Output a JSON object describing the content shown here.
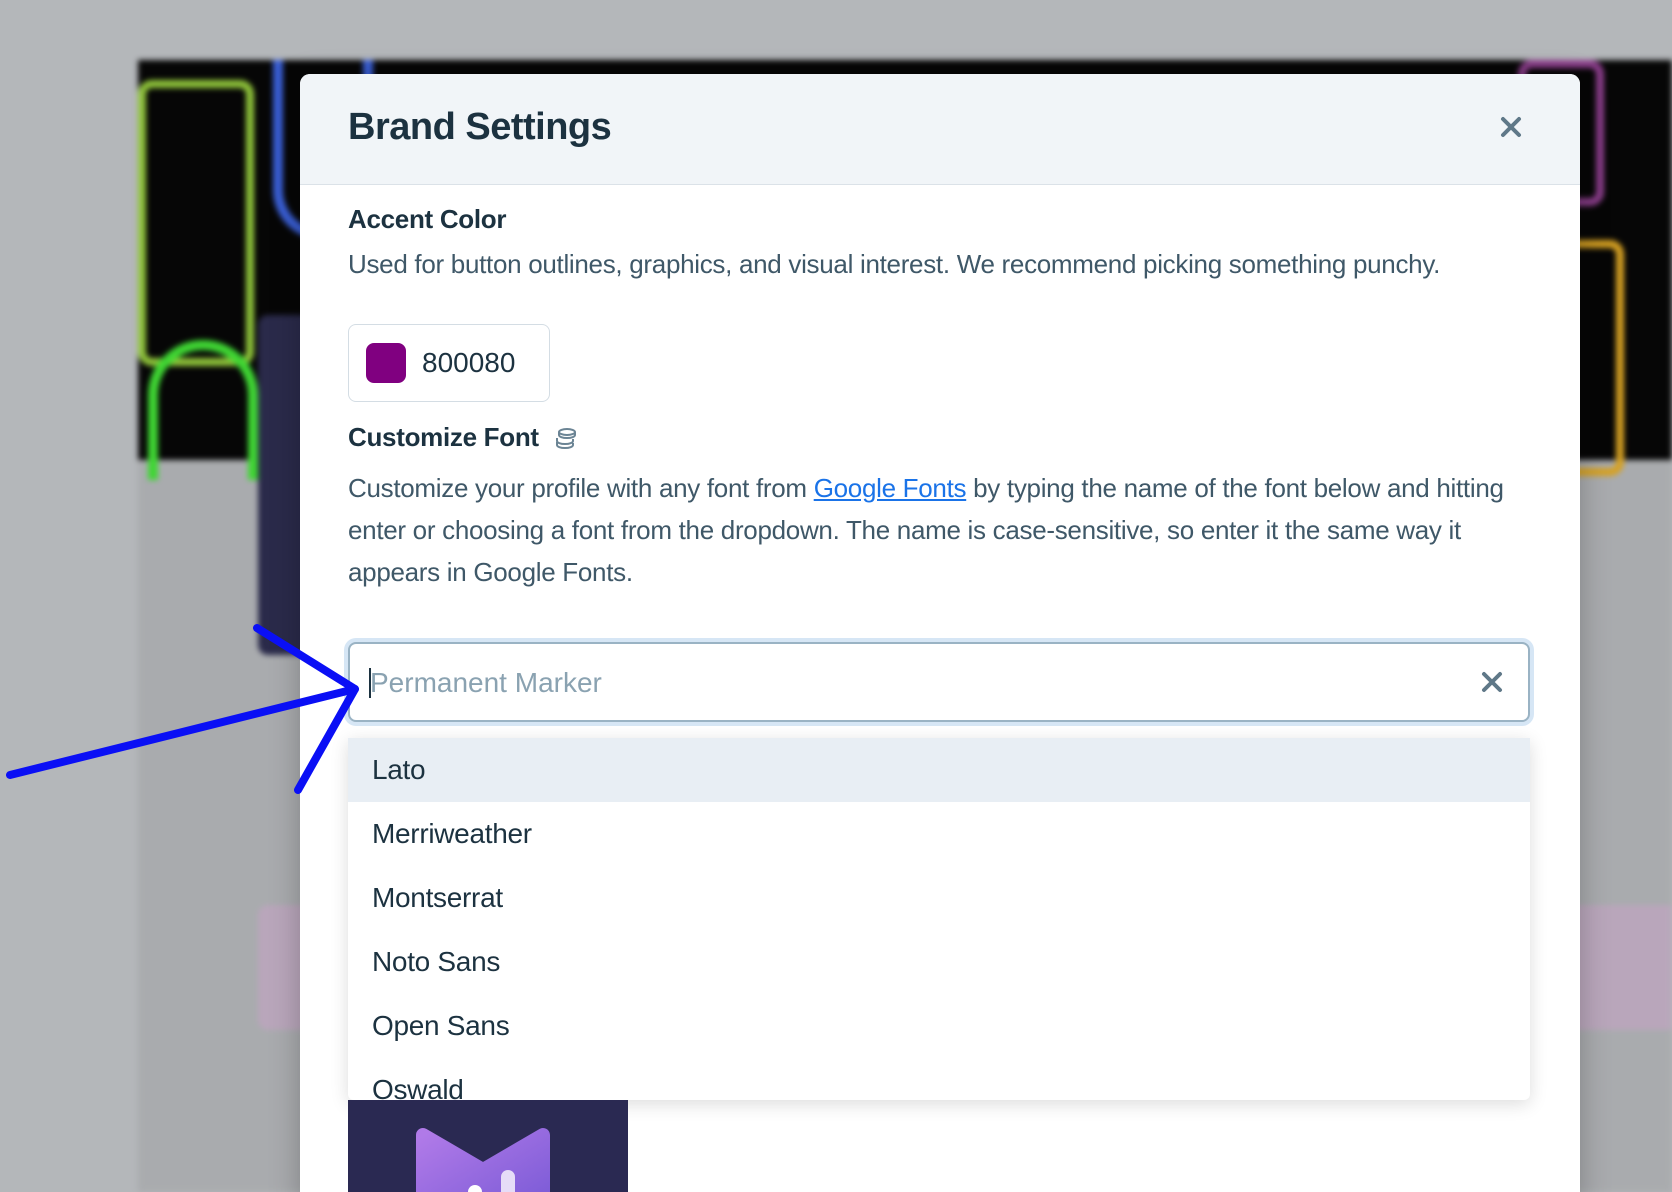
{
  "modal": {
    "title": "Brand Settings",
    "close_icon": "close-icon"
  },
  "accent_color": {
    "label": "Accent Color",
    "description": "Used for button outlines, graphics, and visual interest. We recommend picking something punchy.",
    "value": "800080",
    "swatch_color": "#800080"
  },
  "customize_font": {
    "label": "Customize Font",
    "label_icon": "coins-stack-icon",
    "description_before_link": "Customize your profile with any font from ",
    "link_text": "Google Fonts",
    "description_after_link": " by typing the name of the font below and hitting enter or choosing a font from the dropdown. The name is case-sensitive, so enter it the same way it appears in Google Fonts.",
    "input_placeholder": "Permanent Marker",
    "input_value": "",
    "clear_icon": "clear-icon",
    "options": [
      "Lato",
      "Merriweather",
      "Montserrat",
      "Noto Sans",
      "Open Sans",
      "Oswald"
    ],
    "highlighted_option": "Lato"
  },
  "annotation": {
    "arrow_color": "#0a0ff5"
  }
}
